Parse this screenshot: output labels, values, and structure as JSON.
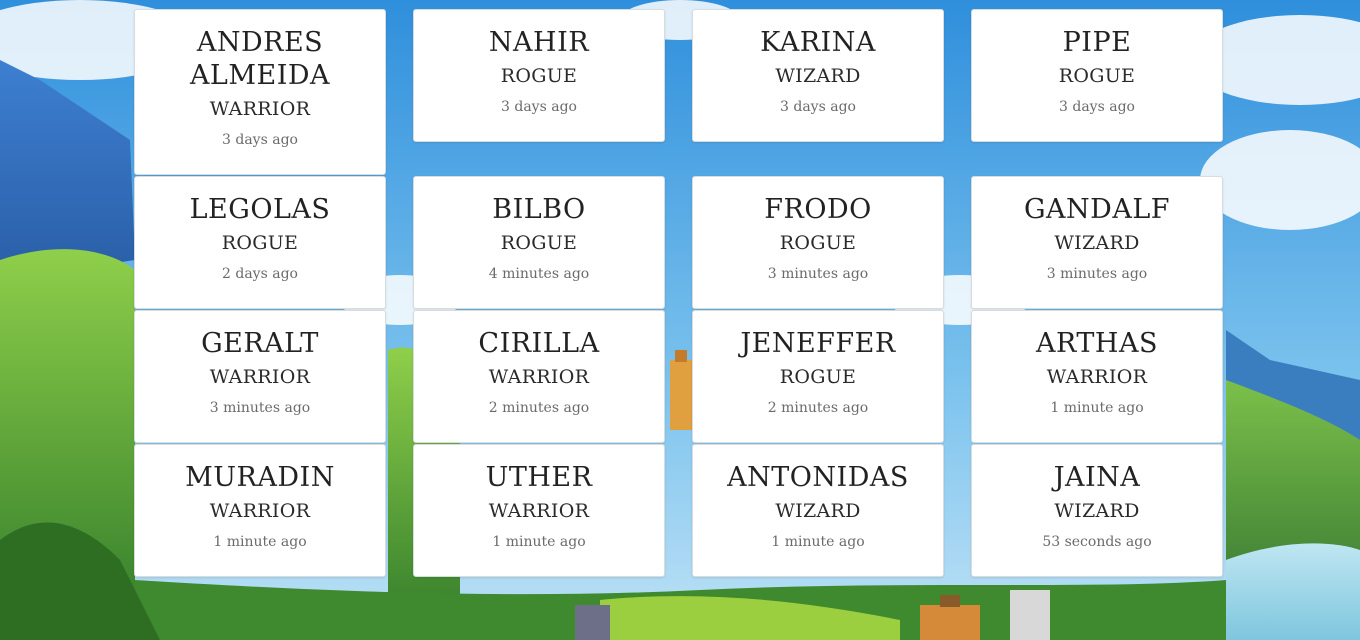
{
  "cards": [
    {
      "name": "ANDRES ALMEIDA",
      "class": "WARRIOR",
      "time": "3 days ago"
    },
    {
      "name": "NAHIR",
      "class": "ROGUE",
      "time": "3 days ago"
    },
    {
      "name": "KARINA",
      "class": "WIZARD",
      "time": "3 days ago"
    },
    {
      "name": "PIPE",
      "class": "ROGUE",
      "time": "3 days ago"
    },
    {
      "name": "LEGOLAS",
      "class": "ROGUE",
      "time": "2 days ago"
    },
    {
      "name": "BILBO",
      "class": "ROGUE",
      "time": "4 minutes ago"
    },
    {
      "name": "FRODO",
      "class": "ROGUE",
      "time": "3 minutes ago"
    },
    {
      "name": "GANDALF",
      "class": "WIZARD",
      "time": "3 minutes ago"
    },
    {
      "name": "GERALT",
      "class": "WARRIOR",
      "time": "3 minutes ago"
    },
    {
      "name": "CIRILLA",
      "class": "WARRIOR",
      "time": "2 minutes ago"
    },
    {
      "name": "JENEFFER",
      "class": "ROGUE",
      "time": "2 minutes ago"
    },
    {
      "name": "ARTHAS",
      "class": "WARRIOR",
      "time": "1 minute ago"
    },
    {
      "name": "MURADIN",
      "class": "WARRIOR",
      "time": "1 minute ago"
    },
    {
      "name": "UTHER",
      "class": "WARRIOR",
      "time": "1 minute ago"
    },
    {
      "name": "ANTONIDAS",
      "class": "WIZARD",
      "time": "1 minute ago"
    },
    {
      "name": "JAINA",
      "class": "WIZARD",
      "time": "53 seconds ago"
    }
  ],
  "colors": {
    "sky": "#4aa3e3",
    "card_bg": "#ffffff",
    "card_border": "#d9dcdf",
    "name_text": "#222222",
    "time_text": "#6b6b6b"
  }
}
